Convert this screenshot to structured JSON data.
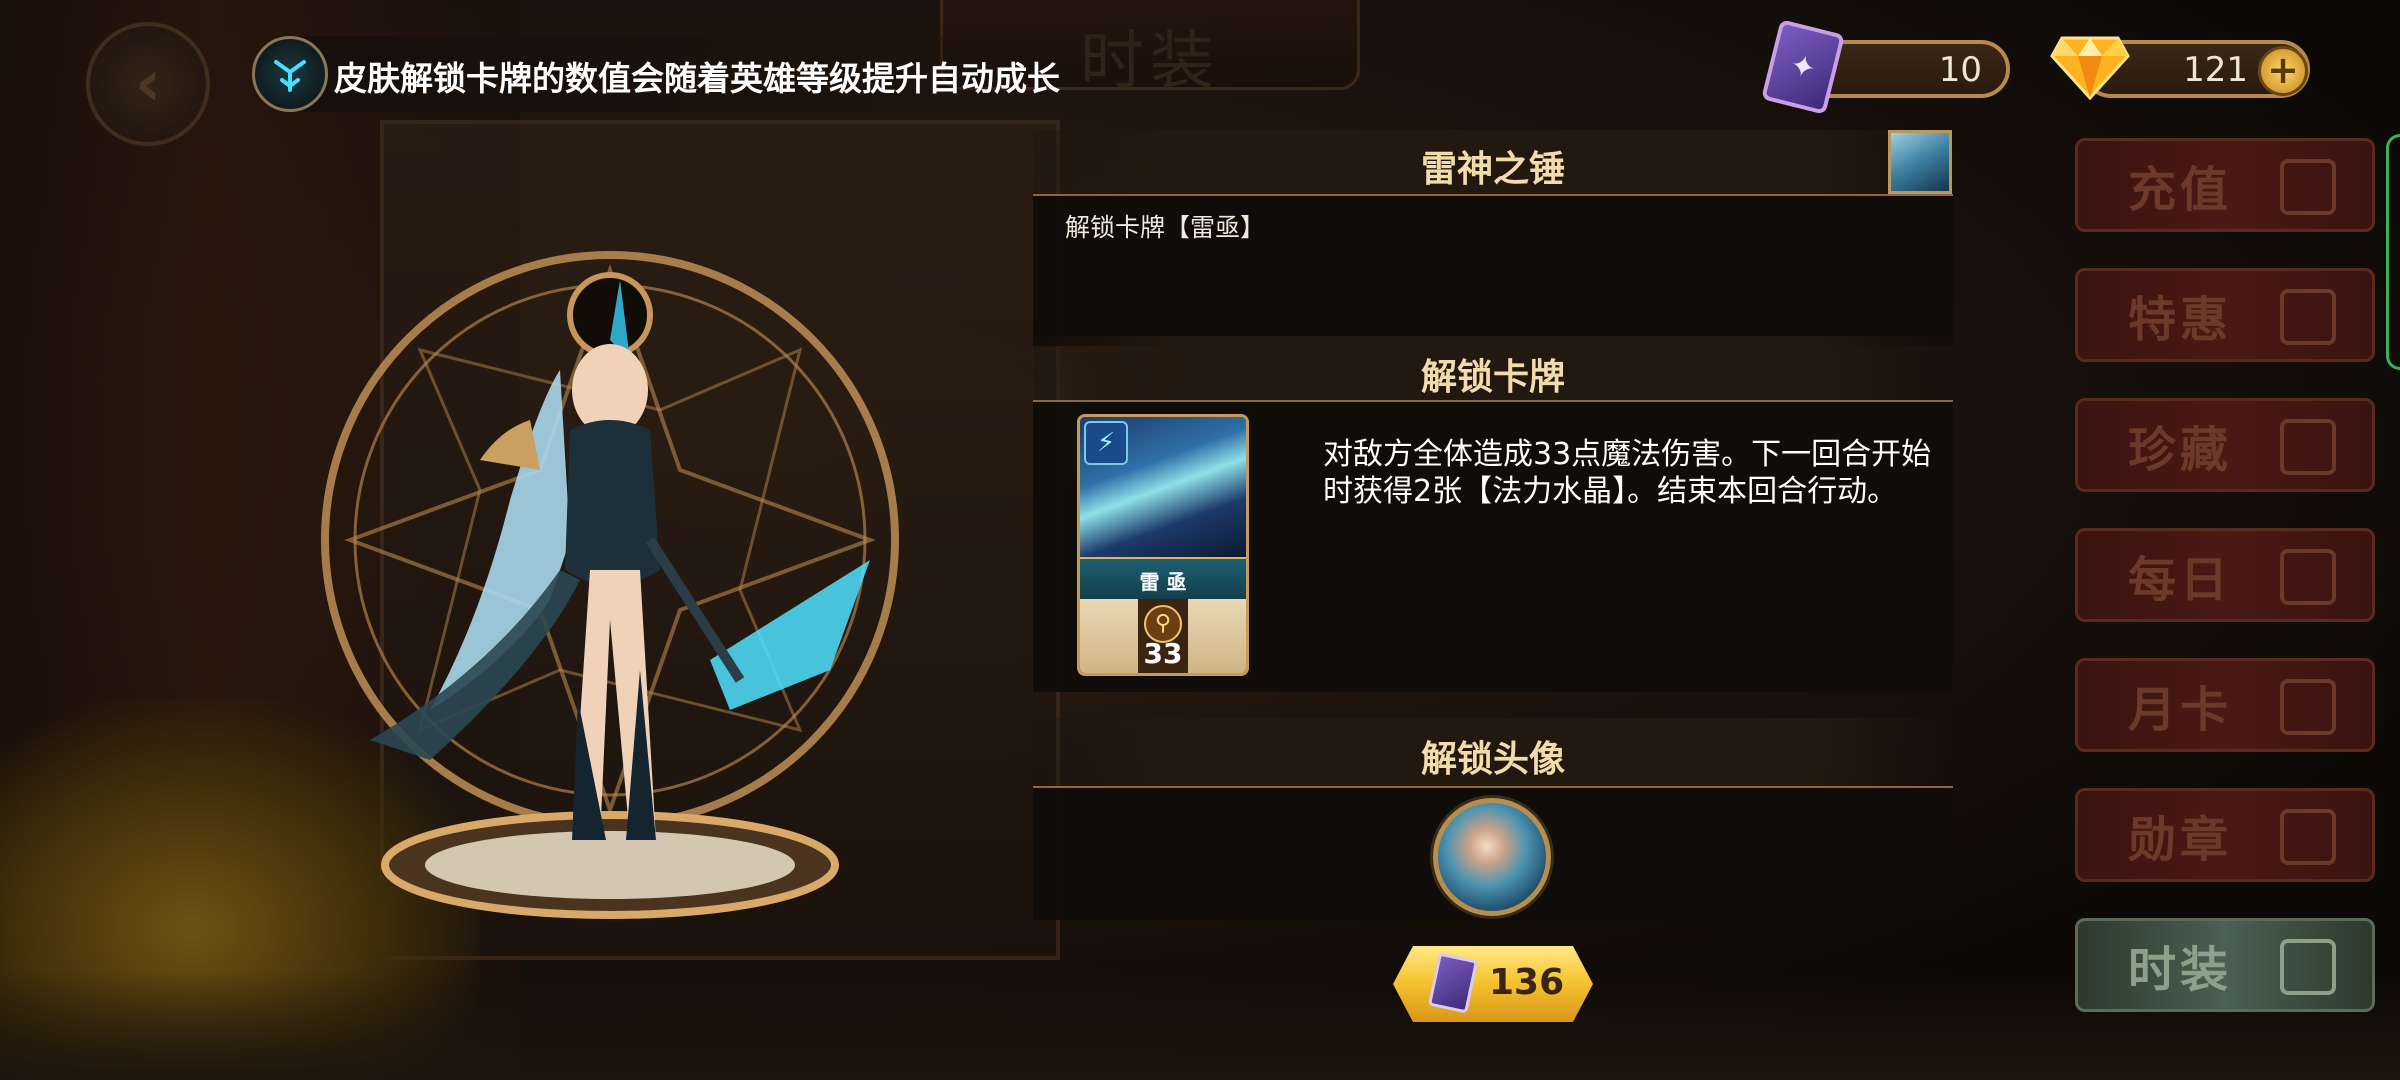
{
  "tip": {
    "text": "皮肤解锁卡牌的数值会随着英雄等级提升自动成长"
  },
  "header": {
    "title": "时装"
  },
  "currency": {
    "cards": "10",
    "gems": "121"
  },
  "side_menu": [
    {
      "label": "充值"
    },
    {
      "label": "特惠"
    },
    {
      "label": "珍藏"
    },
    {
      "label": "每日"
    },
    {
      "label": "月卡"
    },
    {
      "label": "勋章"
    },
    {
      "label": "时装"
    }
  ],
  "skin": {
    "name": "雷神之锤",
    "unlock_text": "解锁卡牌【雷亟】"
  },
  "unlock_card": {
    "section_title": "解锁卡牌",
    "card_name": "雷 亟",
    "card_value": "33",
    "description": "对敌方全体造成33点魔法伤害。下一回合开始时获得2张【法力水晶】。结束本回合行动。"
  },
  "unlock_avatar": {
    "section_title": "解锁头像"
  },
  "price": {
    "value": "136"
  },
  "colors": {
    "accent_gold": "#f3dcab",
    "panel_bg": "#100c09",
    "price_gold": "#f6c531"
  }
}
